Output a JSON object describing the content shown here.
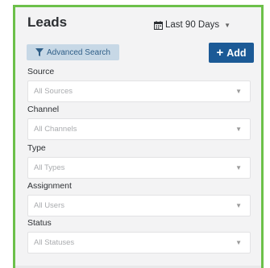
{
  "header": {
    "title": "Leads",
    "date_range": "Last 90 Days"
  },
  "toolbar": {
    "advanced_search_label": "Advanced Search",
    "add_label": "Add"
  },
  "filters": [
    {
      "label": "Source",
      "value": "All Sources"
    },
    {
      "label": "Channel",
      "value": "All Channels"
    },
    {
      "label": "Type",
      "value": "All Types"
    },
    {
      "label": "Assignment",
      "value": "All Users"
    },
    {
      "label": "Status",
      "value": "All Statuses"
    }
  ],
  "colors": {
    "frame_border": "#6cc04a",
    "add_button": "#1c5a96",
    "advanced_search_bg": "#c7d8e6",
    "advanced_search_text": "#305f88"
  },
  "icons": {
    "date_range": "calendar-icon",
    "advanced_search": "filter-icon",
    "add": "plus-icon",
    "dropdown": "caret-down-icon"
  }
}
